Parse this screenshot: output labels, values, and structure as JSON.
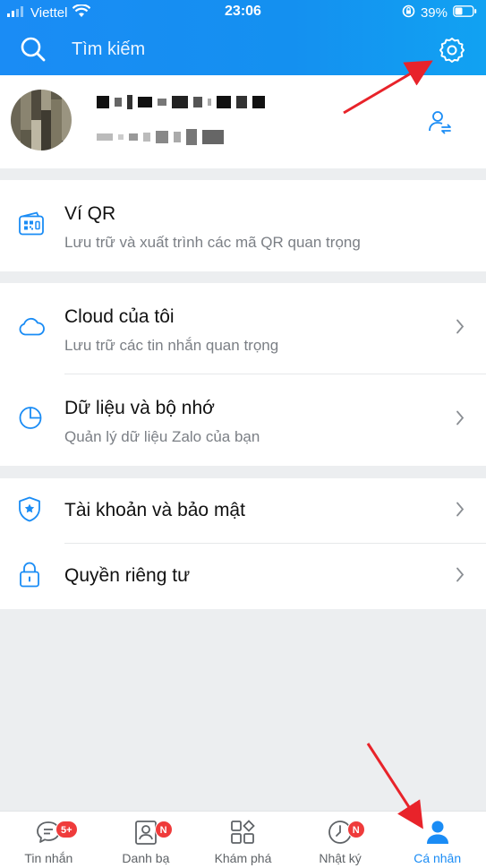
{
  "status_bar": {
    "carrier": "Viettel",
    "time": "23:06",
    "battery": "39%"
  },
  "search": {
    "label": "Tìm kiếm"
  },
  "colors": {
    "brand": "#1a8cf5",
    "badge": "#ef3b3b",
    "arrow": "#e8232a"
  },
  "menu": {
    "qr": {
      "title": "Ví QR",
      "subtitle": "Lưu trữ và xuất trình các mã QR quan trọng"
    },
    "cloud": {
      "title": "Cloud của tôi",
      "subtitle": "Lưu trữ các tin nhắn quan trọng"
    },
    "data": {
      "title": "Dữ liệu và bộ nhớ",
      "subtitle": "Quản lý dữ liệu Zalo của bạn"
    },
    "account": {
      "title": "Tài khoản và bảo mật"
    },
    "privacy": {
      "title": "Quyền riêng tư"
    }
  },
  "nav": [
    {
      "label": "Tin nhắn",
      "badge": "5+",
      "icon": "chat-icon"
    },
    {
      "label": "Danh bạ",
      "badge": "N",
      "icon": "contacts-icon"
    },
    {
      "label": "Khám phá",
      "badge": "",
      "icon": "discover-icon"
    },
    {
      "label": "Nhật ký",
      "badge": "N",
      "icon": "clock-icon"
    },
    {
      "label": "Cá nhân",
      "badge": "",
      "icon": "person-icon",
      "active": true
    }
  ]
}
